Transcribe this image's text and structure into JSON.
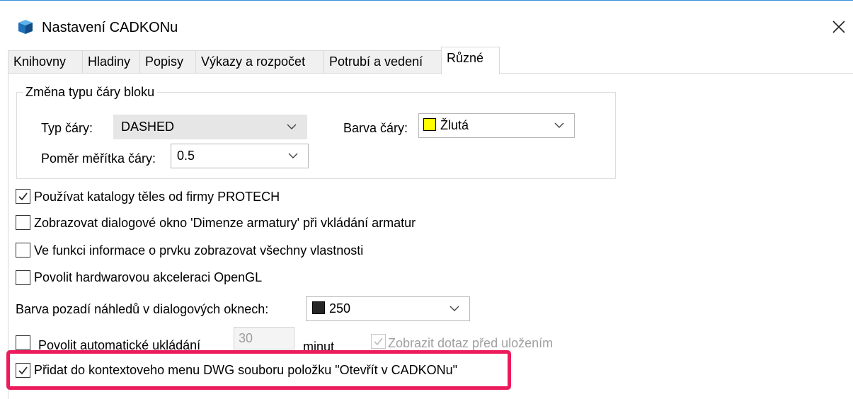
{
  "window": {
    "title": "Nastavení CADKONu",
    "icon": "cadkon-app-icon",
    "close_icon": "close-icon"
  },
  "tabs": [
    {
      "label": "Knihovny",
      "active": false
    },
    {
      "label": "Hladiny",
      "active": false
    },
    {
      "label": "Popisy",
      "active": false
    },
    {
      "label": "Výkazy a rozpočet",
      "active": false
    },
    {
      "label": "Potrubí a vedení",
      "active": false
    },
    {
      "label": "Různé",
      "active": true
    }
  ],
  "line_type_group": {
    "title": "Změna typu čáry bloku",
    "line_type_label": "Typ čáry:",
    "line_type_value": "DASHED",
    "line_color_label": "Barva čáry:",
    "line_color_value": "Žlutá",
    "line_color_swatch": "#ffff00",
    "scale_label": "Poměr měřítka čáry:",
    "scale_value": "0.5"
  },
  "options": {
    "protech_catalogs": {
      "label": "Používat katalogy těles od firmy PROTECH",
      "checked": true
    },
    "dimension_dialog": {
      "label": "Zobrazovat dialogové okno 'Dimenze armatury' při vkládání armatur",
      "checked": false
    },
    "all_properties": {
      "label": "Ve funkci informace o prvku zobrazovat všechny vlastnosti",
      "checked": false
    },
    "opengl": {
      "label": "Povolit hardwarovou akceleraci OpenGL",
      "checked": false
    }
  },
  "preview_bg": {
    "label": "Barva pozadí náhledů v dialogových oknech:",
    "value": "250",
    "swatch": "#262626"
  },
  "autosave": {
    "label": "Povolit automatické ukládání",
    "checked": false,
    "interval_value": "30",
    "unit_label": "minut",
    "confirm_label": "Zobrazit dotaz před uložením",
    "confirm_checked": true,
    "confirm_enabled": false
  },
  "context_menu": {
    "label": "Přidat do kontextoveho menu DWG souboru položku \"Otevřít v CADKONu\"",
    "checked": true
  },
  "highlight_color": "#ec1b5c"
}
